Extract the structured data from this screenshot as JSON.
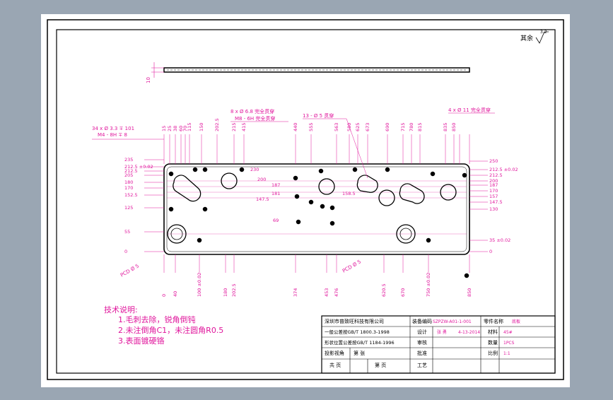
{
  "surface": {
    "roughness_symbol": "3.2",
    "rest_label": "其余"
  },
  "top_view": {
    "thickness": "10"
  },
  "callouts": {
    "c1": "34 x Ø 3.3 ∓ 101",
    "c1b": "M4 - 8H ∓ 8",
    "c2": "8 x Ø 6.8 完全贯穿",
    "c2b": "M8 - 6H 完全贯穿",
    "c3": "13 - Ø 5 贯穿",
    "c4": "4 x Ø 11 完全贯穿",
    "pcd_left": "PCD Ø 5",
    "pcd_right": "PCD Ø 5"
  },
  "top_dims": [
    "15",
    "25",
    "38",
    "60",
    "70",
    "115",
    "150",
    "202.5",
    "215",
    "415",
    "440",
    "555",
    "563",
    "580",
    "625",
    "673",
    "690",
    "715",
    "780",
    "815",
    "835",
    "850"
  ],
  "bottom_dims": [
    "0",
    "40",
    "100 ±0.02",
    "180",
    "202.5",
    "374",
    "453",
    "476",
    "620.5",
    "670",
    "750 ±0.02",
    "850"
  ],
  "left_dims": [
    "235",
    "212.5 ±0.02",
    "212.5",
    "205",
    "180",
    "170",
    "152.5",
    "125",
    "55",
    "0"
  ],
  "mid_dims": [
    "230",
    "200",
    "187",
    "181",
    "147.5",
    "69",
    "158.5"
  ],
  "right_dims": [
    "250",
    "212.5 ±0.02",
    "212.5",
    "200",
    "187",
    "170",
    "157",
    "147.5",
    "130",
    "35 ±0.02",
    "0"
  ],
  "notes": {
    "title": "技术说明:",
    "items": [
      "1.毛刺去除，锐角倒钝",
      "2.未注倒角C1，未注圆角R0.5",
      "3.表面镀硬铬"
    ]
  },
  "title_block": {
    "company": "深圳市普致旺科技有限公司",
    "standard1": "一般公差按GB/T 1800.3-1998",
    "standard2": "形状位置公差按GB/T 1184-1996",
    "scale_label": "投影视角",
    "sheet_label": "第  张",
    "total": "共    页",
    "page": "第    页",
    "part_no_label": "装备编码",
    "part_name_label": "零件名称",
    "part_no_value": "SZPZW-A01-1-001",
    "part_name_value": "底板",
    "design_label": "设计",
    "designer": "张  勇",
    "date": "4-13-2014",
    "check_label": "审核",
    "approve_label": "批准",
    "craft_label": "工艺",
    "material_label": "材料",
    "material_value": "45#",
    "qty_label": "数量",
    "qty_value": "1PCS",
    "ratio_label": "比例",
    "ratio_value": "1:1"
  },
  "colors": {
    "dim": "#e0169c",
    "line": "#000000",
    "sheet": "#ffffff",
    "frame_bg": "#9aa6b3"
  }
}
